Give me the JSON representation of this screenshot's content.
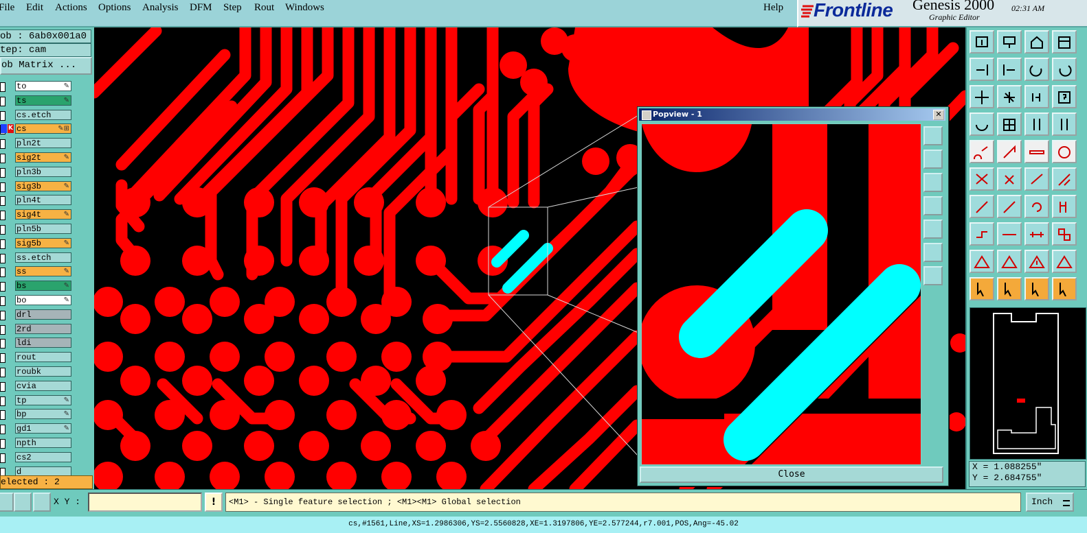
{
  "menu": {
    "items": [
      "File",
      "Edit",
      "Actions",
      "Options",
      "Analysis",
      "DFM",
      "Step",
      "Rout",
      "Windows"
    ],
    "help": "Help"
  },
  "brand": {
    "logo": "Frontline",
    "product": "Genesis 2000",
    "subtitle": "Graphic Editor",
    "time": "02:31 AM"
  },
  "job": {
    "job_label": "ob : 6ab0x001a0",
    "step_label": "tep: cam",
    "matrix_button": "ob Matrix ..."
  },
  "layers": [
    {
      "name": "to",
      "color": "#ffffff",
      "mark": "✎"
    },
    {
      "name": "ts",
      "color": "#2aa36d",
      "mark": "✎"
    },
    {
      "name": "cs.etch",
      "color": "#a5d9d6",
      "mark": ""
    },
    {
      "name": "cs",
      "color": "#f7b244",
      "mark": "✎⊞",
      "active": true
    },
    {
      "name": "pln2t",
      "color": "#a5d9d6",
      "mark": ""
    },
    {
      "name": "sig2t",
      "color": "#f7b244",
      "mark": "✎"
    },
    {
      "name": "pln3b",
      "color": "#a5d9d6",
      "mark": ""
    },
    {
      "name": "sig3b",
      "color": "#f7b244",
      "mark": "✎"
    },
    {
      "name": "pln4t",
      "color": "#a5d9d6",
      "mark": ""
    },
    {
      "name": "sig4t",
      "color": "#f7b244",
      "mark": "✎"
    },
    {
      "name": "pln5b",
      "color": "#a5d9d6",
      "mark": ""
    },
    {
      "name": "sig5b",
      "color": "#f7b244",
      "mark": "✎"
    },
    {
      "name": "ss.etch",
      "color": "#a5d9d6",
      "mark": ""
    },
    {
      "name": "ss",
      "color": "#f7b244",
      "mark": "✎"
    },
    {
      "name": "bs",
      "color": "#2aa36d",
      "mark": "✎"
    },
    {
      "name": "bo",
      "color": "#ffffff",
      "mark": "✎"
    },
    {
      "name": "drl",
      "color": "#a6b4b8",
      "mark": ""
    },
    {
      "name": "2rd",
      "color": "#a6b4b8",
      "mark": ""
    },
    {
      "name": "ldi",
      "color": "#a6b4b8",
      "mark": ""
    },
    {
      "name": "rout",
      "color": "#a5d9d6",
      "mark": ""
    },
    {
      "name": "roubk",
      "color": "#a5d9d6",
      "mark": ""
    },
    {
      "name": "cvia",
      "color": "#a5d9d6",
      "mark": ""
    },
    {
      "name": "tp",
      "color": "#a5d9d6",
      "mark": "✎"
    },
    {
      "name": "bp",
      "color": "#a5d9d6",
      "mark": "✎"
    },
    {
      "name": "gd1",
      "color": "#a5d9d6",
      "mark": "✎"
    },
    {
      "name": "npth",
      "color": "#a5d9d6",
      "mark": ""
    },
    {
      "name": "cs2",
      "color": "#a5d9d6",
      "mark": ""
    },
    {
      "name": "d",
      "color": "#a5d9d6",
      "mark": ""
    }
  ],
  "active_flag": "K",
  "selected_status": "elected : 2",
  "popview": {
    "title": "Popview - 1",
    "close_label": "Close"
  },
  "coords": {
    "x": "X = 1.088255\"",
    "y": "Y = 2.684755\""
  },
  "statusbar": {
    "xy_label": "X Y :",
    "xy_placeholder": "",
    "alert": "!",
    "hint": "<M1> - Single feature selection ; <M1><M1> Global selection",
    "units": "Inch"
  },
  "feature_line": "cs,#1561,Line,XS=1.2986306,YS=2.5560828,XE=1.3197806,YE=2.577244,r7.001,POS,Ang=-45.02",
  "colors": {
    "copper": "#ff0000",
    "selected": "#00ffff",
    "background": "#000000",
    "panel": "#6fcabd"
  }
}
